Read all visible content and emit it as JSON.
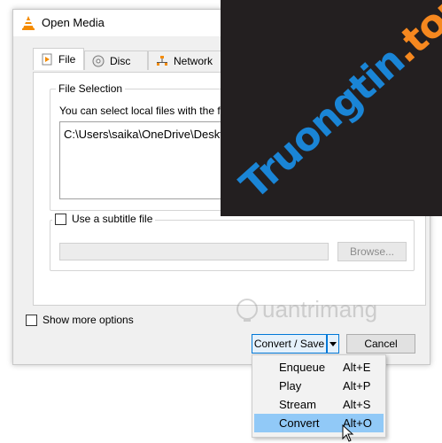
{
  "window": {
    "title": "Open Media"
  },
  "tabs": [
    {
      "label": "File",
      "icon": "file-play-icon"
    },
    {
      "label": "Disc",
      "icon": "disc-icon"
    },
    {
      "label": "Network",
      "icon": "network-icon"
    }
  ],
  "file_selection": {
    "legend": "File Selection",
    "description": "You can select local files with the follow",
    "files": [
      "C:\\Users\\saika\\OneDrive\\Desktop"
    ]
  },
  "subtitle": {
    "checkbox_label": "Use a subtitle file",
    "checked": false,
    "browse_label": "Browse..."
  },
  "show_more": {
    "label": "Show more options",
    "checked": false
  },
  "buttons": {
    "convert_save": "Convert / Save",
    "cancel": "Cancel"
  },
  "dropdown_menu": [
    {
      "label": "Enqueue",
      "shortcut": "Alt+E",
      "highlighted": false
    },
    {
      "label": "Play",
      "shortcut": "Alt+P",
      "highlighted": false
    },
    {
      "label": "Stream",
      "shortcut": "Alt+S",
      "highlighted": false
    },
    {
      "label": "Convert",
      "shortcut": "Alt+O",
      "highlighted": true
    }
  ],
  "watermarks": {
    "overlay_part1": "Truongtin",
    "overlay_part2": ".top",
    "logo_text": "uantrimang"
  },
  "colors": {
    "highlight": "#91c9f7",
    "overlay_bg": "#231f20",
    "watermark_blue": "#1a85d6",
    "watermark_orange": "#f6881f"
  }
}
